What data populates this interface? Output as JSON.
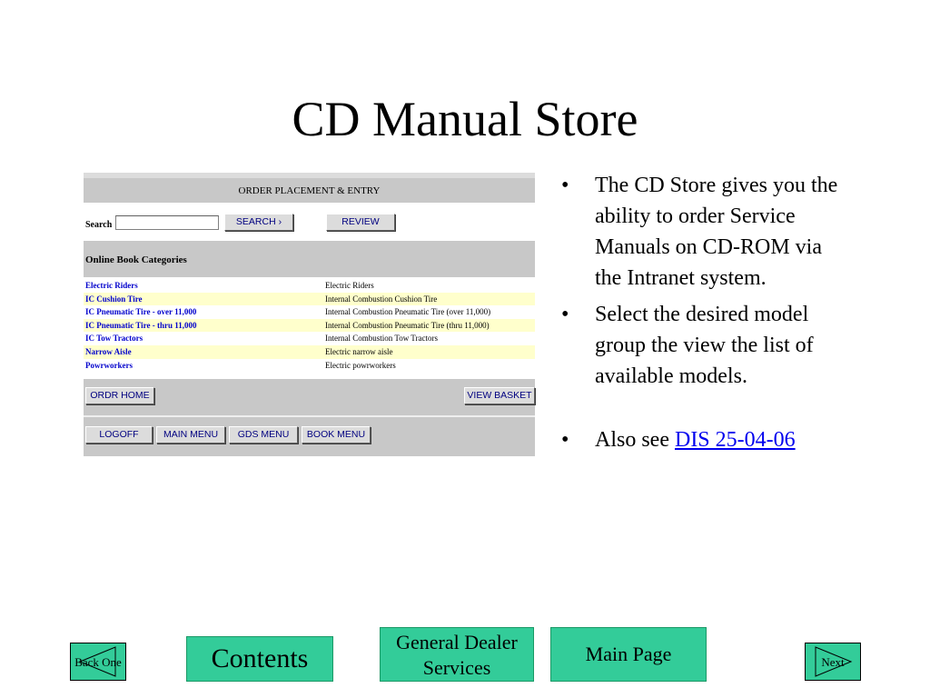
{
  "slide": {
    "title": "CD Manual Store"
  },
  "panel": {
    "header": "ORDER PLACEMENT & ENTRY",
    "search_label": "Search",
    "search_value": "",
    "search_button": "SEARCH ›",
    "review_button": "REVIEW",
    "categories_title": "Online Book Categories",
    "rows": [
      {
        "name": "Electric Riders",
        "desc": "Electric Riders"
      },
      {
        "name": "IC Cushion Tire",
        "desc": "Internal Combustion Cushion Tire"
      },
      {
        "name": "IC Pneumatic Tire - over 11,000",
        "desc": "Internal Combustion Pneumatic Tire (over 11,000)"
      },
      {
        "name": "IC Pneumatic Tire - thru 11,000",
        "desc": "Internal Combustion Pneumatic Tire (thru 11,000)"
      },
      {
        "name": "IC Tow Tractors",
        "desc": "Internal Combustion Tow Tractors"
      },
      {
        "name": "Narrow Aisle",
        "desc": "Electric narrow aisle"
      },
      {
        "name": "Powrworkers",
        "desc": "Electric powrworkers"
      }
    ],
    "buttons": {
      "ordr_home": "ORDR HOME",
      "view_basket": "VIEW BASKET",
      "logoff": "LOGOFF",
      "main_menu": "MAIN MENU",
      "gds_menu": "GDS MENU",
      "book_menu": "BOOK MENU"
    }
  },
  "bullets": {
    "b1": "The CD Store gives you the ability to order Service Manuals on CD-ROM via the Intranet system.",
    "b2": "Select the desired model group the view the list of available models.",
    "b3_text": "Also see ",
    "b3_link": "DIS 25-04-06"
  },
  "nav": {
    "back": "Back One",
    "contents": "Contents",
    "general_dealer": "General Dealer Services",
    "main_page": "Main Page",
    "next": "Next"
  },
  "colors": {
    "nav_green": "#33cc99",
    "row_highlight": "#ffffcc",
    "link_blue": "#0000cc",
    "panel_gray": "#c8c8c8"
  }
}
